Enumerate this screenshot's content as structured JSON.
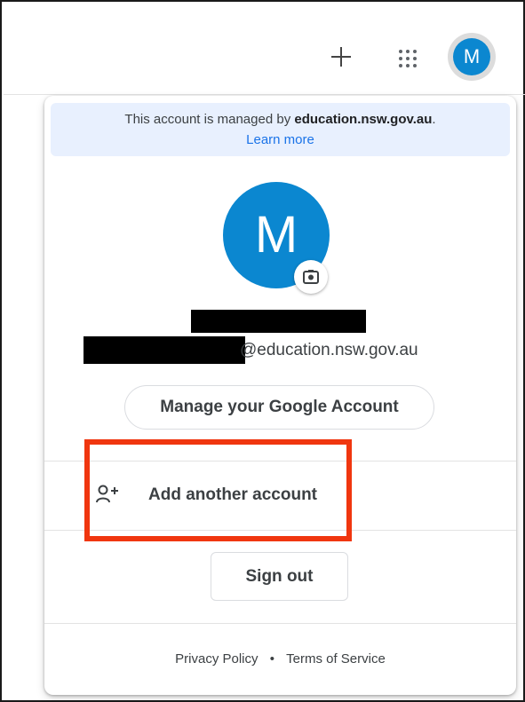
{
  "topbar": {
    "create_icon": "plus-icon",
    "apps_icon": "apps-grid-icon",
    "avatar_initial": "M"
  },
  "account_popup": {
    "managed_prefix": "This account is managed by ",
    "managed_domain": "education.nsw.gov.au",
    "managed_suffix": ".",
    "learn_more": "Learn more",
    "avatar_initial": "M",
    "camera_icon": "camera-icon",
    "email_visible_part": "@education.nsw.gov.au",
    "manage_account_label": "Manage your Google Account",
    "add_account_label": "Add another account",
    "add_account_icon": "person-add-icon",
    "sign_out_label": "Sign out",
    "footer": {
      "privacy": "Privacy Policy",
      "separator": "•",
      "terms": "Terms of Service"
    }
  },
  "colors": {
    "avatar": "#0b87d0",
    "banner_bg": "#e8f0fe",
    "link": "#1a73e8",
    "highlight": "#f0360f"
  }
}
